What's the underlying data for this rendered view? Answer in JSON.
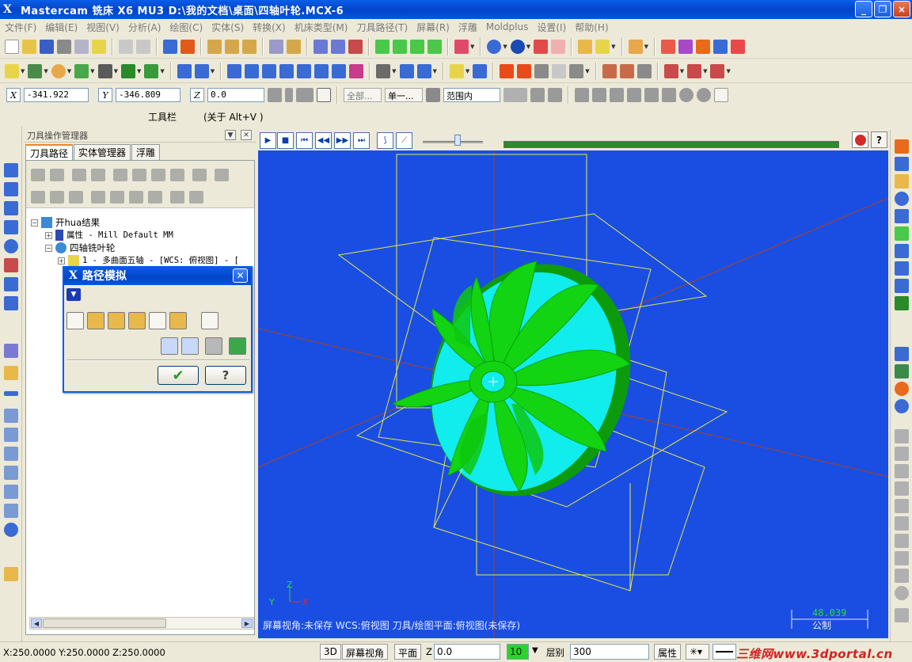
{
  "window": {
    "title": "Mastercam 铣床 X6 MU3  D:\\我的文档\\桌面\\四轴叶轮.MCX-6",
    "app_icon": "X",
    "minimize": "_",
    "maximize": "❐",
    "close": "×"
  },
  "menu": [
    "文件(F)",
    "编辑(E)",
    "视图(V)",
    "分析(A)",
    "绘图(C)",
    "实体(S)",
    "转换(X)",
    "机床类型(M)",
    "刀具路径(T)",
    "屏幕(R)",
    "浮雕",
    "Moldplus",
    "设置(I)",
    "帮助(H)"
  ],
  "coordbar": {
    "x_label": "X",
    "x_value": "-341.922",
    "y_label": "Y",
    "y_value": "-346.809",
    "z_label": "Z",
    "z_value": "0.0",
    "select_all": "全部...",
    "select_single": "单一...",
    "range": "范围内"
  },
  "captions": {
    "toolbar": "工具栏",
    "about": "(关于 Alt+V )"
  },
  "op_manager": {
    "title": "刀具操作管理器",
    "tabs": [
      "刀具路径",
      "实体管理器",
      "浮雕"
    ],
    "tree": [
      {
        "label": "开hua结果"
      },
      {
        "label": "属性 - Mill Default MM"
      },
      {
        "label": "四轴铣叶轮"
      },
      {
        "label": "1 - 多曲面五轴 - [WCS: 俯视图] - ["
      }
    ]
  },
  "sim_dialog": {
    "title": "路径模拟",
    "ok": "✔",
    "help": "?"
  },
  "viewport": {
    "status": "屏幕视角:未保存    WCS:俯视图    刀具/绘图平面:俯视图(未保存)",
    "scale_value": "48.039",
    "scale_unit": "公制",
    "axis_x": "X",
    "axis_y": "Y",
    "axis_z": "Z"
  },
  "statusbar": {
    "coords": "X:250.0000  Y:250.0000  Z:250.0000",
    "btn_3d": "3D",
    "btn_view": "屏幕视角",
    "btn_plane": "平面",
    "z_label": "Z",
    "z_value": "0.0",
    "color_value": "10",
    "level_label": "层别",
    "level_value": "300",
    "attr_label": "属性",
    "watermark": "三维网www.3dportal.cn"
  },
  "colors": {
    "viewport_bg": "#1a4ee2",
    "impeller_green": "#12d412",
    "hub_cyan": "#11ecec",
    "wire_yellow": "#e8e84a",
    "title_blue": "#0a5ee8"
  }
}
